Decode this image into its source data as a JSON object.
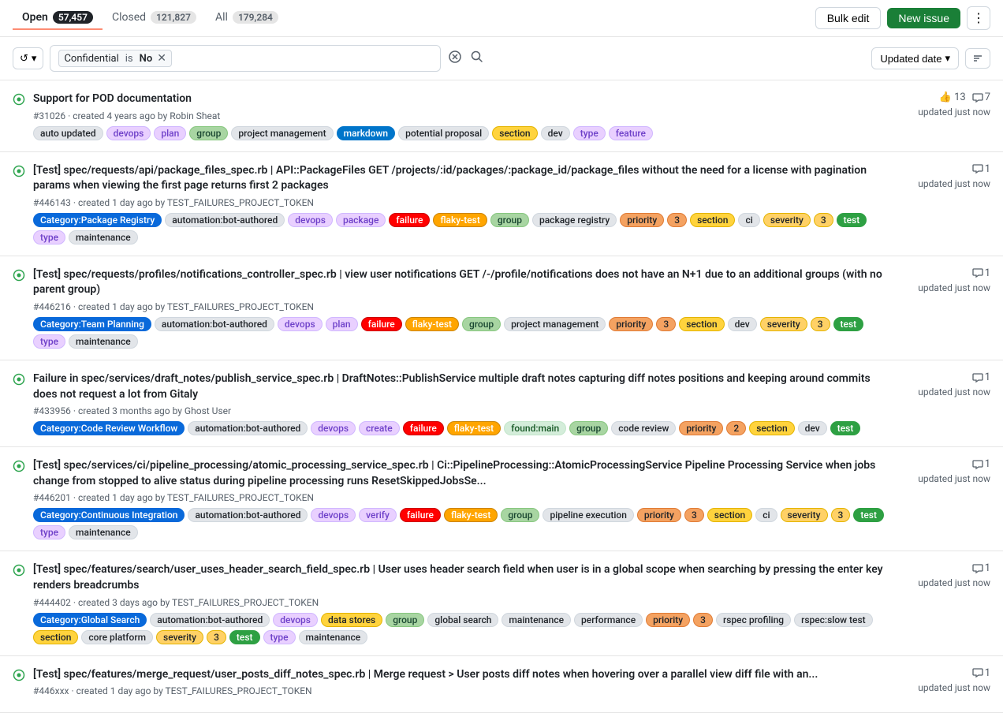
{
  "tabs": {
    "open": {
      "label": "Open",
      "count": "57,457"
    },
    "closed": {
      "label": "Closed",
      "count": "121,827"
    },
    "all": {
      "label": "All",
      "count": "179,284"
    }
  },
  "toolbar": {
    "bulk_edit": "Bulk edit",
    "new_issue": "New issue",
    "more_options": "⋮"
  },
  "filter": {
    "history_icon": "↺",
    "filter_label": "Confidential",
    "filter_op": "is",
    "filter_val": "No",
    "sort_label": "Updated date",
    "sort_icon": "↕"
  },
  "issues": [
    {
      "id": "issue-1",
      "number": "#31026",
      "title": "Support for POD documentation",
      "meta": "created 4 years ago by Robin Sheat",
      "reactions": "13",
      "comments": "7",
      "updated": "updated just now",
      "labels": [
        {
          "text": "auto updated",
          "class": "label-auto-updated"
        },
        {
          "text": "devops",
          "class": "label-devops"
        },
        {
          "text": "plan",
          "class": "label-plan"
        },
        {
          "text": "group",
          "class": "label-group"
        },
        {
          "text": "project management",
          "class": "label-project-mgmt"
        },
        {
          "text": "markdown",
          "class": "label-markdown"
        },
        {
          "text": "potential proposal",
          "class": "label-potential-proposal"
        },
        {
          "text": "section",
          "class": "label-section"
        },
        {
          "text": "dev",
          "class": "label-dev"
        },
        {
          "text": "type",
          "class": "label-type"
        },
        {
          "text": "feature",
          "class": "label-feature"
        }
      ]
    },
    {
      "id": "issue-2",
      "number": "#446143",
      "title": "[Test] spec/requests/api/package_files_spec.rb | API::PackageFiles GET /projects/:id/packages/:package_id/package_files without the need for a license with pagination params when viewing the first page returns first 2 packages",
      "meta": "created 1 day ago by TEST_FAILURES_PROJECT_TOKEN",
      "reactions": null,
      "comments": "1",
      "updated": "updated just now",
      "labels": [
        {
          "text": "Category:Package Registry",
          "class": "label-category-pkg"
        },
        {
          "text": "automation:bot-authored",
          "class": "label-automation"
        },
        {
          "text": "devops",
          "class": "label-devops"
        },
        {
          "text": "package",
          "class": "label-package"
        },
        {
          "text": "failure",
          "class": "label-failure"
        },
        {
          "text": "flaky-test",
          "class": "label-flaky-test"
        },
        {
          "text": "group",
          "class": "label-group"
        },
        {
          "text": "package registry",
          "class": "label-package-registry"
        },
        {
          "text": "priority",
          "class": "label-priority"
        },
        {
          "text": "3",
          "class": "label-priority"
        },
        {
          "text": "section",
          "class": "label-section"
        },
        {
          "text": "ci",
          "class": "label-ci"
        },
        {
          "text": "severity",
          "class": "label-severity"
        },
        {
          "text": "3",
          "class": "label-severity"
        },
        {
          "text": "test",
          "class": "label-test"
        },
        {
          "text": "type",
          "class": "label-type"
        },
        {
          "text": "maintenance",
          "class": "label-maintenance"
        }
      ]
    },
    {
      "id": "issue-3",
      "number": "#446216",
      "title": "[Test] spec/requests/profiles/notifications_controller_spec.rb | view user notifications GET /-/profile/notifications does not have an N+1 due to an additional groups (with no parent group)",
      "meta": "created 1 day ago by TEST_FAILURES_PROJECT_TOKEN",
      "reactions": null,
      "comments": "1",
      "updated": "updated just now",
      "labels": [
        {
          "text": "Category:Team Planning",
          "class": "label-category-team"
        },
        {
          "text": "automation:bot-authored",
          "class": "label-automation"
        },
        {
          "text": "devops",
          "class": "label-devops"
        },
        {
          "text": "plan",
          "class": "label-plan"
        },
        {
          "text": "failure",
          "class": "label-failure"
        },
        {
          "text": "flaky-test",
          "class": "label-flaky-test"
        },
        {
          "text": "group",
          "class": "label-group"
        },
        {
          "text": "project management",
          "class": "label-project-mgmt"
        },
        {
          "text": "priority",
          "class": "label-priority"
        },
        {
          "text": "3",
          "class": "label-priority"
        },
        {
          "text": "section",
          "class": "label-section"
        },
        {
          "text": "dev",
          "class": "label-dev"
        },
        {
          "text": "severity",
          "class": "label-severity"
        },
        {
          "text": "3",
          "class": "label-severity"
        },
        {
          "text": "test",
          "class": "label-test"
        },
        {
          "text": "type",
          "class": "label-type"
        },
        {
          "text": "maintenance",
          "class": "label-maintenance"
        }
      ]
    },
    {
      "id": "issue-4",
      "number": "#433956",
      "title": "Failure in spec/services/draft_notes/publish_service_spec.rb | DraftNotes::PublishService multiple draft notes capturing diff notes positions and keeping around commits does not request a lot from Gitaly",
      "meta": "created 3 months ago by Ghost User",
      "reactions": null,
      "comments": "1",
      "updated": "updated just now",
      "labels": [
        {
          "text": "Category:Code Review Workflow",
          "class": "label-category-code"
        },
        {
          "text": "automation:bot-authored",
          "class": "label-automation"
        },
        {
          "text": "devops",
          "class": "label-devops"
        },
        {
          "text": "create",
          "class": "label-create"
        },
        {
          "text": "failure",
          "class": "label-failure"
        },
        {
          "text": "flaky-test",
          "class": "label-flaky-test"
        },
        {
          "text": "found:main",
          "class": "label-found-main"
        },
        {
          "text": "group",
          "class": "label-group"
        },
        {
          "text": "code review",
          "class": "label-code-review"
        },
        {
          "text": "priority",
          "class": "label-priority"
        },
        {
          "text": "2",
          "class": "label-priority"
        },
        {
          "text": "section",
          "class": "label-section"
        },
        {
          "text": "dev",
          "class": "label-dev"
        },
        {
          "text": "test",
          "class": "label-test"
        }
      ]
    },
    {
      "id": "issue-5",
      "number": "#446201",
      "title": "[Test] spec/services/ci/pipeline_processing/atomic_processing_service_spec.rb | Ci::PipelineProcessing::AtomicProcessingService Pipeline Processing Service when jobs change from stopped to alive status during pipeline processing runs ResetSkippedJobsSe...",
      "meta": "created 1 day ago by TEST_FAILURES_PROJECT_TOKEN",
      "reactions": null,
      "comments": "1",
      "updated": "updated just now",
      "labels": [
        {
          "text": "Category:Continuous Integration",
          "class": "label-category-ci"
        },
        {
          "text": "automation:bot-authored",
          "class": "label-automation"
        },
        {
          "text": "devops",
          "class": "label-devops"
        },
        {
          "text": "verify",
          "class": "label-verify"
        },
        {
          "text": "failure",
          "class": "label-failure"
        },
        {
          "text": "flaky-test",
          "class": "label-flaky-test"
        },
        {
          "text": "group",
          "class": "label-group"
        },
        {
          "text": "pipeline execution",
          "class": "label-pipeline-exec"
        },
        {
          "text": "priority",
          "class": "label-priority"
        },
        {
          "text": "3",
          "class": "label-priority"
        },
        {
          "text": "section",
          "class": "label-section"
        },
        {
          "text": "ci",
          "class": "label-ci"
        },
        {
          "text": "severity",
          "class": "label-severity"
        },
        {
          "text": "3",
          "class": "label-severity"
        },
        {
          "text": "test",
          "class": "label-test"
        },
        {
          "text": "type",
          "class": "label-type"
        },
        {
          "text": "maintenance",
          "class": "label-maintenance"
        }
      ]
    },
    {
      "id": "issue-6",
      "number": "#444402",
      "title": "[Test] spec/features/search/user_uses_header_search_field_spec.rb | User uses header search field when user is in a global scope when searching by pressing the enter key renders breadcrumbs",
      "meta": "created 3 days ago by TEST_FAILURES_PROJECT_TOKEN",
      "reactions": null,
      "comments": "1",
      "updated": "updated just now",
      "labels": [
        {
          "text": "Category:Global Search",
          "class": "label-category-global"
        },
        {
          "text": "automation:bot-authored",
          "class": "label-automation"
        },
        {
          "text": "devops",
          "class": "label-devops"
        },
        {
          "text": "data stores",
          "class": "label-data-stores"
        },
        {
          "text": "group",
          "class": "label-group"
        },
        {
          "text": "global search",
          "class": "label-global-search"
        },
        {
          "text": "maintenance",
          "class": "label-maint-outline"
        },
        {
          "text": "performance",
          "class": "label-performance"
        },
        {
          "text": "priority",
          "class": "label-priority"
        },
        {
          "text": "3",
          "class": "label-priority"
        },
        {
          "text": "rspec profiling",
          "class": "label-rspec-profiling"
        },
        {
          "text": "rspec:slow test",
          "class": "label-rspec-slow"
        },
        {
          "text": "section",
          "class": "label-section"
        },
        {
          "text": "core platform",
          "class": "label-core-platform"
        },
        {
          "text": "severity",
          "class": "label-severity"
        },
        {
          "text": "3",
          "class": "label-severity"
        },
        {
          "text": "test",
          "class": "label-test"
        },
        {
          "text": "type",
          "class": "label-type"
        },
        {
          "text": "maintenance",
          "class": "label-maintenance"
        }
      ]
    },
    {
      "id": "issue-7",
      "number": "#446xxx",
      "title": "[Test] spec/features/merge_request/user_posts_diff_notes_spec.rb | Merge request > User posts diff notes when hovering over a parallel view diff file with an...",
      "meta": "created 1 day ago by TEST_FAILURES_PROJECT_TOKEN",
      "reactions": null,
      "comments": "1",
      "updated": "updated just now",
      "labels": []
    }
  ]
}
